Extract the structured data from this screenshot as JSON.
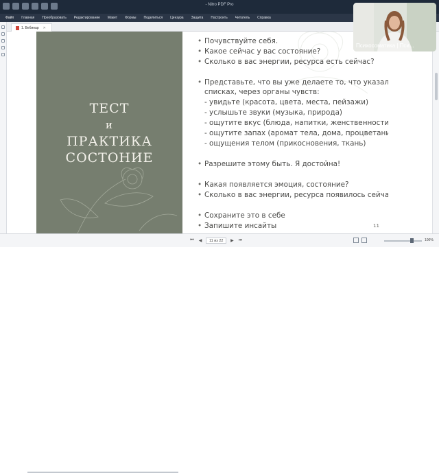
{
  "app": {
    "title": "- Nitro PDF Pro"
  },
  "menu": [
    "Файл",
    "Главная",
    "Преобразовать",
    "Редактирование",
    "Макет",
    "Формы",
    "Поделиться",
    "Цензура",
    "Защита",
    "Настроить",
    "Читатель",
    "Справка"
  ],
  "tab": {
    "label": "1. Вебинар"
  },
  "slide": {
    "title_lines": [
      "ТЕСТ",
      "и",
      "ПРАКТИКА",
      "СОСТОНИЕ"
    ],
    "bullets": [
      {
        "text": "Почувствуйте себя.",
        "dot": true
      },
      {
        "text": "Какое сейчас у вас состояние?",
        "dot": true
      },
      {
        "text": "Сколько в вас энергии, ресурса есть сейчас?",
        "dot": true
      },
      {
        "text": "Представьте, что вы уже делаете то, что указали в",
        "dot": true
      },
      {
        "text": "списках, через органы чувств:",
        "dot": false
      },
      {
        "text": "- увидьте (красота, цвета, места, пейзажи)",
        "dot": false
      },
      {
        "text": "- услышьте звуки (музыка, природа)",
        "dot": false
      },
      {
        "text": "- ощутите вкус (блюда, напитки, женственности)",
        "dot": false
      },
      {
        "text": "- ощутите запах (аромат тела, дома, процветания)",
        "dot": false
      },
      {
        "text": "- ощущения телом (прикосновения, ткань)",
        "dot": false
      },
      {
        "text": "Разрешите этому быть. Я достойна!",
        "dot": true
      },
      {
        "text": "Какая появляется эмоция, состояние?",
        "dot": true
      },
      {
        "text": "Сколько в вас энергии, ресурса появилось сейчас?",
        "dot": true
      },
      {
        "text": "Сохраните это в себе",
        "dot": true
      },
      {
        "text": "Запишите инсайты",
        "dot": true
      }
    ],
    "page_number": "11"
  },
  "status": {
    "page_indicator": "11 из 22",
    "zoom": "100%"
  },
  "webcam": {
    "label": "Психосоматика | Пси..."
  },
  "colors": {
    "slide_green": "#767e6f",
    "text_gray": "#4a4a48",
    "titlebar": "#1e2a3a"
  }
}
